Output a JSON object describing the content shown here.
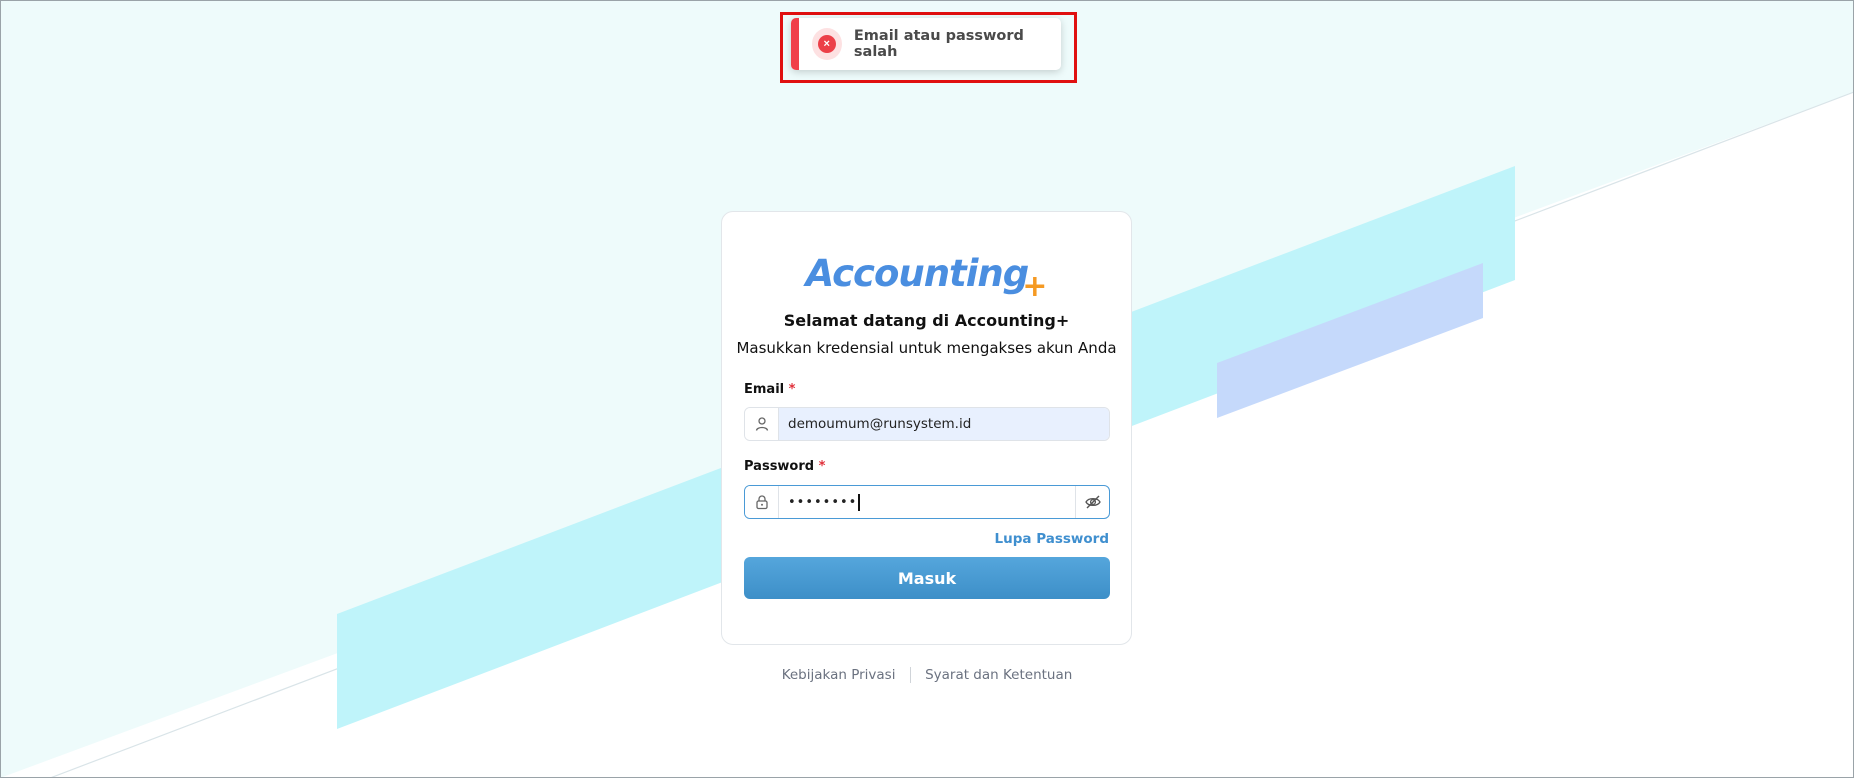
{
  "toast": {
    "message": "Email atau password salah",
    "icon": "error-icon",
    "accent_color": "#f0404a"
  },
  "brand": {
    "logo_text": "Accounting",
    "logo_plus": "+",
    "primary_color": "#4a8ee0",
    "plus_color": "#f59a23"
  },
  "login": {
    "title": "Selamat datang di Accounting+",
    "subtitle": "Masukkan kredensial untuk mengakses akun Anda",
    "email_label": "Email",
    "email_value": "demoumum@runsystem.id",
    "password_label": "Password",
    "password_masked": "••••••••",
    "required_mark": "*",
    "forgot_label": "Lupa Password",
    "submit_label": "Masuk"
  },
  "footer": {
    "privacy": "Kebijakan Privasi",
    "terms": "Syarat dan Ketentuan"
  }
}
